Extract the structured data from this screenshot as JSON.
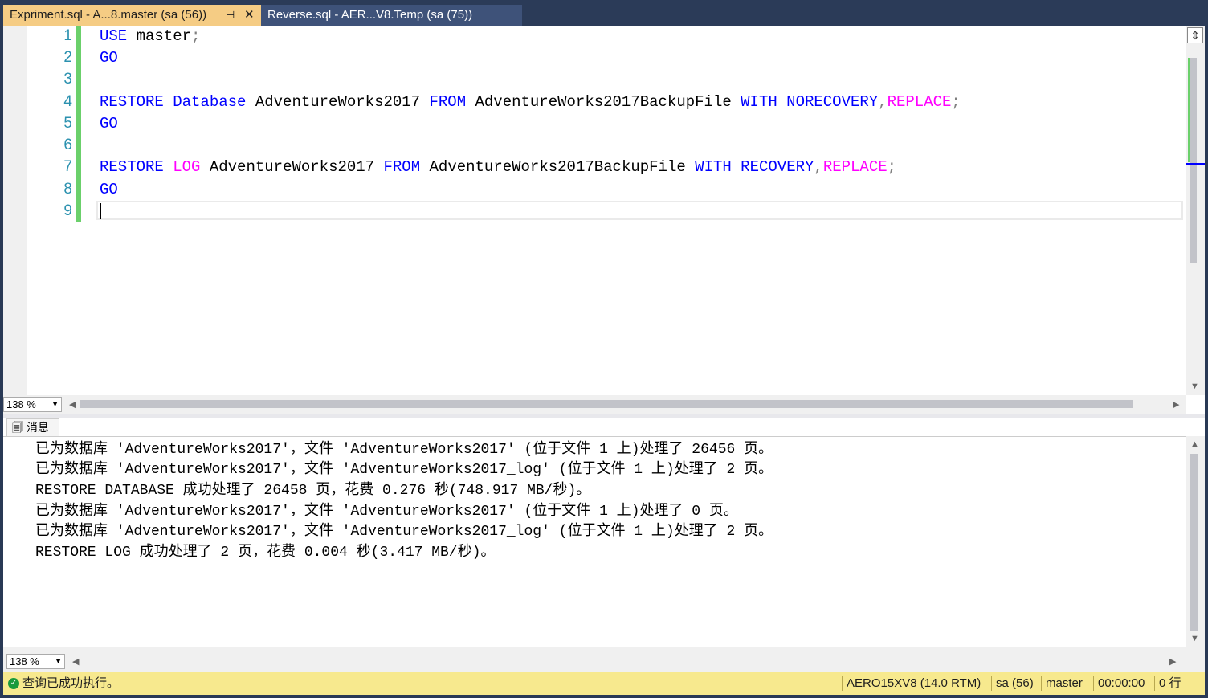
{
  "tabs": [
    {
      "label": "Expriment.sql - A...8.master (sa (56))",
      "pin": "⊣",
      "close": "✕"
    },
    {
      "label": "Reverse.sql - AER...V8.Temp (sa (75))"
    }
  ],
  "editor": {
    "line_numbers": [
      "1",
      "2",
      "3",
      "4",
      "5",
      "6",
      "7",
      "8",
      "9"
    ],
    "lines": {
      "l1_kw": "USE",
      "l1_rest": " master",
      "l1_semi": ";",
      "l2": "GO",
      "l4_kw1": "RESTORE Database",
      "l4_t1": " AdventureWorks2017 ",
      "l4_kw2": "FROM",
      "l4_t2": " AdventureWorks2017BackupFile ",
      "l4_kw3": "WITH NORECOVERY",
      "l4_comma": ",",
      "l4_pk": "REPLACE",
      "l4_semi": ";",
      "l5": "GO",
      "l7_kw1": "RESTORE",
      "l7_pk1": "LOG",
      "l7_t1": " AdventureWorks2017 ",
      "l7_kw2": "FROM",
      "l7_t2": " AdventureWorks2017BackupFile ",
      "l7_kw3": "WITH RECOVERY",
      "l7_comma": ",",
      "l7_pk": "REPLACE",
      "l7_semi": ";",
      "l8": "GO"
    }
  },
  "zoom_top": "138 %",
  "zoom_bottom": "138 %",
  "messages_tab": "消息",
  "messages": [
    "已为数据库 'AdventureWorks2017'，文件 'AdventureWorks2017' (位于文件 1 上)处理了 26456 页。",
    "已为数据库 'AdventureWorks2017'，文件 'AdventureWorks2017_log' (位于文件 1 上)处理了 2 页。",
    "RESTORE DATABASE 成功处理了 26458 页，花费 0.276 秒(748.917 MB/秒)。",
    "已为数据库 'AdventureWorks2017'，文件 'AdventureWorks2017' (位于文件 1 上)处理了 0 页。",
    "已为数据库 'AdventureWorks2017'，文件 'AdventureWorks2017_log' (位于文件 1 上)处理了 2 页。",
    "RESTORE LOG 成功处理了 2 页，花费 0.004 秒(3.417 MB/秒)。"
  ],
  "status": {
    "message": "查询已成功执行。",
    "server": "AERO15XV8 (14.0 RTM)",
    "user": "sa (56)",
    "database": "master",
    "elapsed": "00:00:00",
    "rows": "0 行"
  },
  "colors": {
    "keyword": "#0000ff",
    "function": "#ff00ff",
    "status_bg": "#f7e98e",
    "tab_active": "#f5cc84"
  }
}
